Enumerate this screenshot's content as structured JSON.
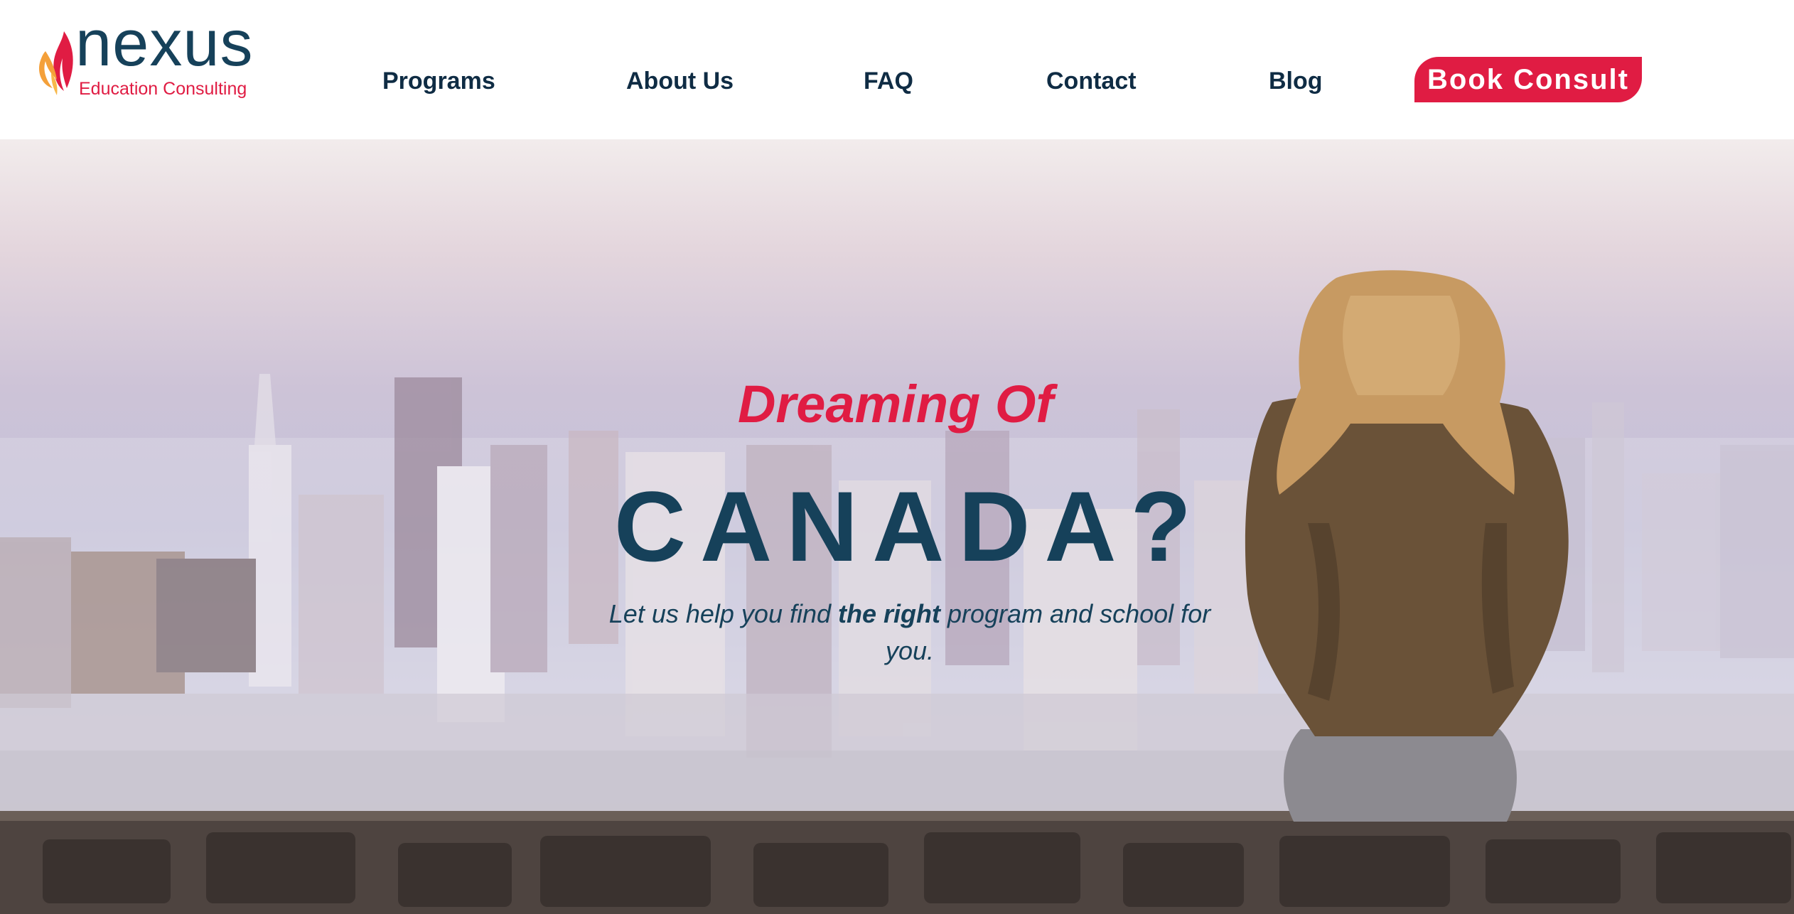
{
  "brand": {
    "name": "nexus",
    "tagline": "Education Consulting",
    "logo_icon": "flame-leaf-icon",
    "colors": {
      "navy": "#16415a",
      "accent": "#e01c43",
      "flame_orange": "#f4a03a"
    }
  },
  "nav": {
    "items": [
      {
        "label": "Programs"
      },
      {
        "label": "About Us"
      },
      {
        "label": "FAQ"
      },
      {
        "label": "Contact"
      },
      {
        "label": "Blog"
      }
    ],
    "cta_label": "Book Consult"
  },
  "hero": {
    "kicker": "Dreaming Of",
    "title": "CANADA?",
    "subtitle_part1": "Let us help you find ",
    "subtitle_emphasis": "the right",
    "subtitle_part2": " program and school for you.",
    "background": "photo of a woman sitting on a stone wall looking out over a hazy city skyline"
  }
}
